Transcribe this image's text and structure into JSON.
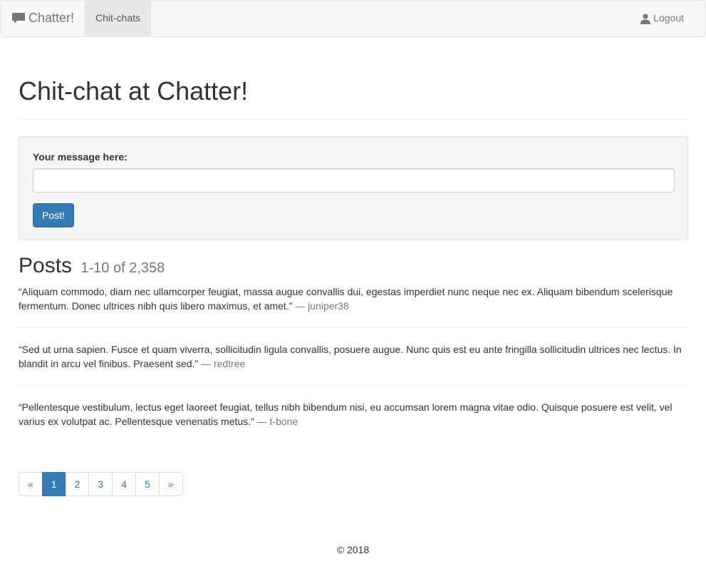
{
  "navbar": {
    "brand_icon": "comment-icon",
    "brand": "Chatter!",
    "active_item": "Chit-chats",
    "logout_icon": "user-icon",
    "logout": "Logout"
  },
  "page": {
    "title": "Chit-chat at Chatter!"
  },
  "form": {
    "label": "Your message here:",
    "input_value": "",
    "input_placeholder": "",
    "submit": "Post!"
  },
  "posts_section": {
    "heading": "Posts",
    "range": "1-10 of 2,358"
  },
  "posts": [
    {
      "text": "“Aliquam commodo, diam nec ullamcorper feugiat, massa augue convallis dui, egestas imperdiet nunc neque nec ex. Aliquam bibendum scelerisque fermentum. Donec ultrices nibh quis libero maximus, et amet.”",
      "author": "— juniper38"
    },
    {
      "text": "“Sed ut urna sapien. Fusce et quam viverra, sollicitudin ligula convallis, posuere augue. Nunc quis est eu ante fringilla sollicitudin ultrices nec lectus. In blandit in arcu vel finibus. Praesent sed.”",
      "author": "— redtree"
    },
    {
      "text": "“Pellentesque vestibulum, lectus eget laoreet feugiat, tellus nibh bibendum nisi, eu accumsan lorem magna vitae odio. Quisque posuere est velit, vel varius ex volutpat ac. Pellentesque venenatis metus.”",
      "author": "— t-bone"
    }
  ],
  "pagination": {
    "prev": "«",
    "pages": [
      "1",
      "2",
      "3",
      "4",
      "5"
    ],
    "active_page": "1",
    "next": "»"
  },
  "footer": {
    "text": "© 2018"
  },
  "colors": {
    "primary": "#337ab7",
    "navbar_bg": "#f8f8f8",
    "muted": "#777777"
  }
}
